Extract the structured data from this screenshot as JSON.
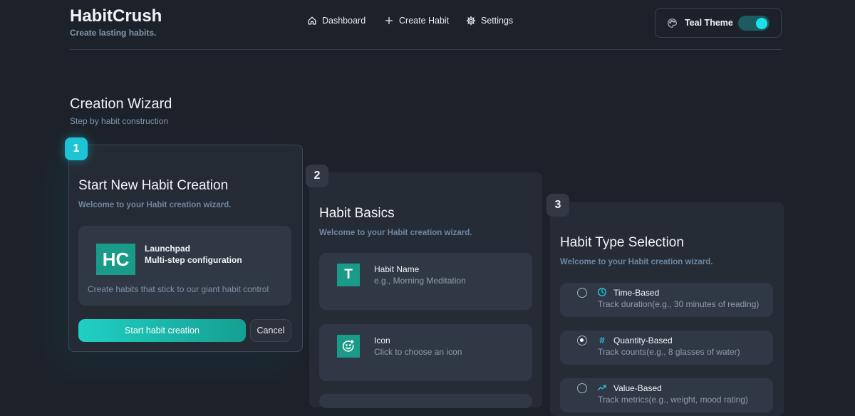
{
  "brand": {
    "name": "HabitCrush",
    "tagline": "Create lasting habits."
  },
  "nav": [
    {
      "label": "Dashboard",
      "icon": "home-icon"
    },
    {
      "label": "Create Habit",
      "icon": "plus-icon"
    },
    {
      "label": "Settings",
      "icon": "gear-icon"
    }
  ],
  "theme": {
    "label": "Teal Theme",
    "icon": "palette-icon",
    "enabled": true,
    "accent": "#1dc4d6"
  },
  "section": {
    "title": "Creation Wizard",
    "subtitle": "Step by habit construction"
  },
  "steps": [
    {
      "number": "1",
      "title": "Start New Habit Creation",
      "subtitle": "Welcome to your Habit creation wizard.",
      "launchpad": {
        "logo": "HC",
        "name": "Launchpad",
        "detail": "Multi-step configuration",
        "description": "Create habits that stick to our giant habit control"
      },
      "primary_button": "Start habit creation",
      "cancel_button": "Cancel"
    },
    {
      "number": "2",
      "title": "Habit Basics",
      "subtitle": "Welcome to your Habit creation wizard.",
      "fields": [
        {
          "icon_text": "T",
          "label": "Habit Name",
          "hint": "e.g., Morning Meditation"
        },
        {
          "icon_text": "",
          "label": "Icon",
          "hint": "Click to choose an icon"
        }
      ]
    },
    {
      "number": "3",
      "title": "Habit Type Selection",
      "subtitle": "Welcome to your Habit creation wizard.",
      "options": [
        {
          "label": "Time-Based",
          "description": "Track duration(e.g., 30 minutes of reading)",
          "icon": "clock-icon",
          "selected": false
        },
        {
          "label": "Quantity-Based",
          "description": "Track counts(e.g., 8 glasses of water)",
          "icon": "hash-icon",
          "selected": true
        },
        {
          "label": "Value-Based",
          "description": "Track metrics(e.g., weight, mood rating)",
          "icon": "trend-up-icon",
          "selected": false
        }
      ]
    }
  ]
}
